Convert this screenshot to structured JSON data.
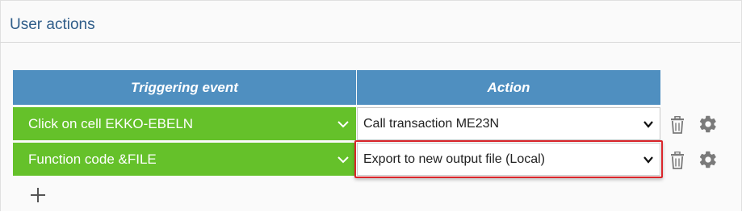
{
  "section": {
    "title": "User actions"
  },
  "table": {
    "headers": {
      "trigger": "Triggering event",
      "action": "Action"
    },
    "rows": [
      {
        "trigger": "Click on cell EKKO-EBELN",
        "action": "Call transaction ME23N",
        "highlighted": false
      },
      {
        "trigger": "Function code &FILE",
        "action": "Export to new output file (Local)",
        "highlighted": true
      }
    ]
  },
  "icons": {
    "delete": "trash-icon",
    "settings": "gear-icon",
    "add": "plus-icon",
    "dropdown": "chevron-down-icon"
  },
  "colors": {
    "title": "#2f5d89",
    "header_bg": "#4f8fc0",
    "trigger_bg": "#65c12a",
    "highlight_border": "#d9252a",
    "icon_gray": "#7a7a7a"
  }
}
